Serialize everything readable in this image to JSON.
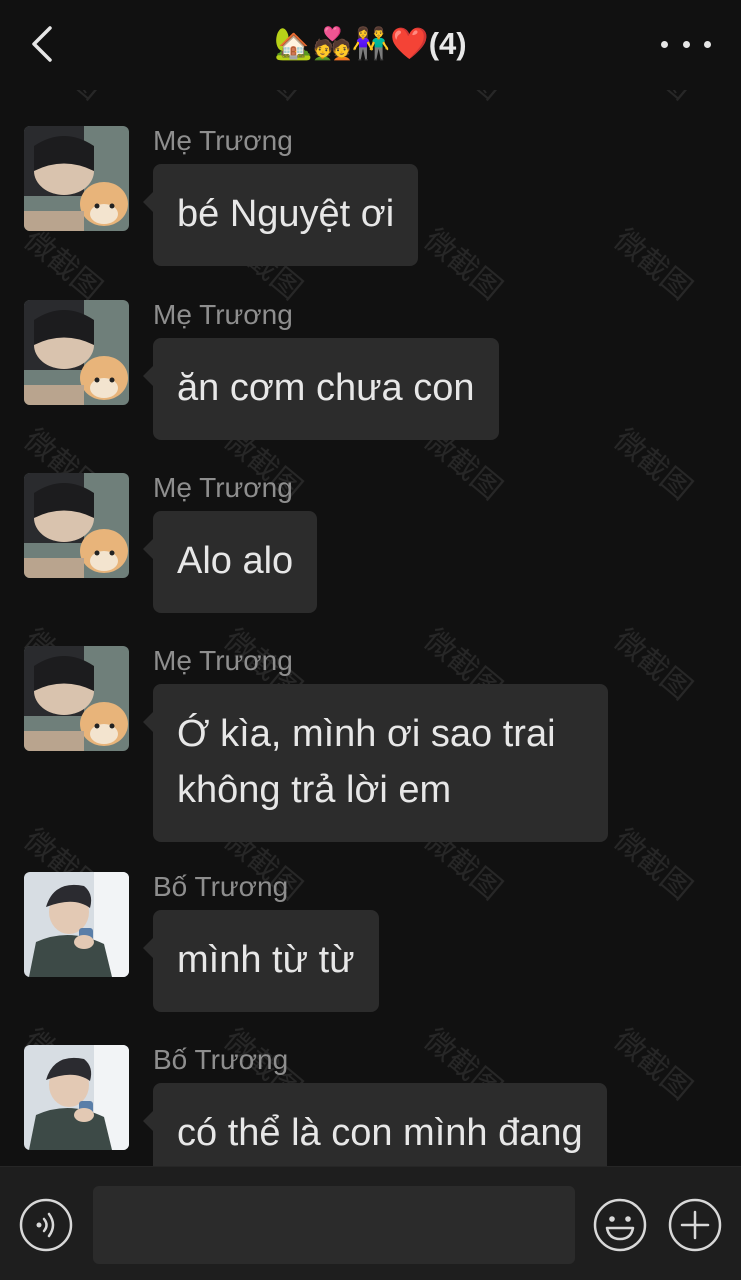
{
  "header": {
    "title": "🏡💑👫❤️(4)"
  },
  "messages": [
    {
      "sender": "Mẹ Trương",
      "text": "bé Nguyệt ơi",
      "avatar": "dog-photo-avatar"
    },
    {
      "sender": "Mẹ Trương",
      "text": "ăn cơm chưa con",
      "avatar": "dog-photo-avatar"
    },
    {
      "sender": "Mẹ Trương",
      "text": "Alo alo",
      "avatar": "dog-photo-avatar"
    },
    {
      "sender": "Mẹ Trương",
      "text": "Ớ kìa, mình ơi sao trai không trả lời em",
      "avatar": "dog-photo-avatar"
    },
    {
      "sender": "Bố Trương",
      "text": "mình từ từ",
      "avatar": "man-photo-avatar"
    },
    {
      "sender": "Bố Trương",
      "text": "có thể là con mình đang",
      "avatar": "man-photo-avatar"
    }
  ],
  "input": {
    "placeholder": "",
    "icons": [
      "voice-icon",
      "emoji-icon",
      "plus-icon"
    ]
  },
  "watermark": {
    "text": "微截图"
  },
  "colors": {
    "background": "#111111",
    "bubble": "#2c2c2c",
    "sender": "#8e8e8e",
    "input_bar": "#1e1e1e"
  }
}
